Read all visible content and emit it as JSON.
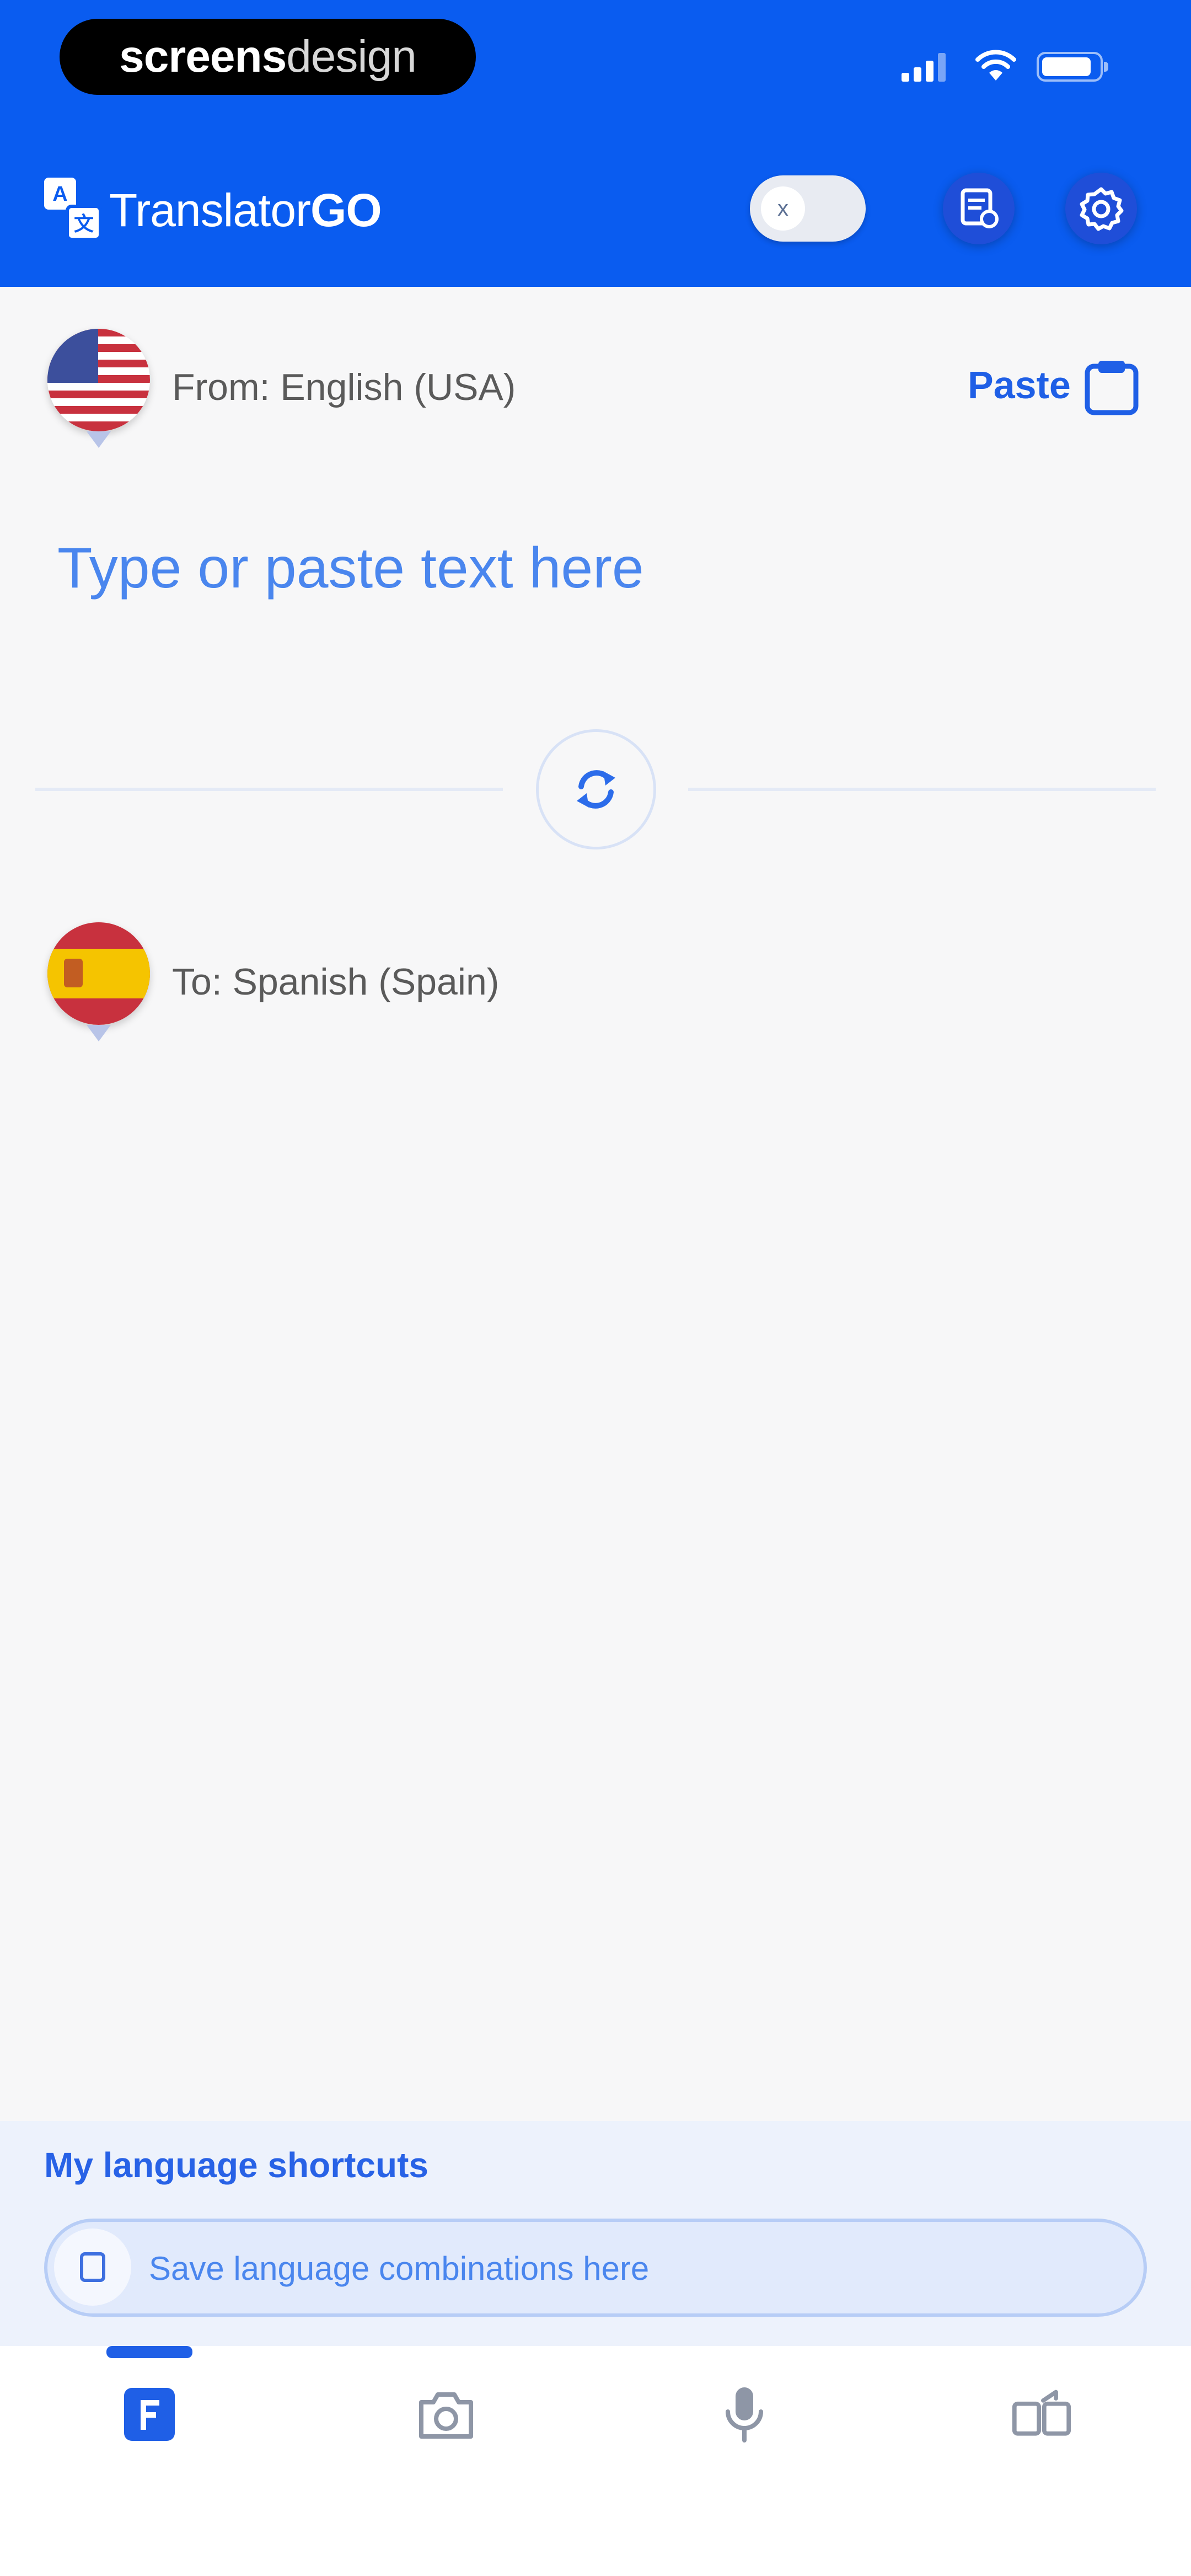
{
  "watermark": {
    "bold": "screens",
    "light": "design"
  },
  "header": {
    "app_title_prefix": "Translator",
    "app_title_suffix": "GO",
    "toggle_state_label": "x",
    "accent": "#0a5cf0"
  },
  "source": {
    "label": "From: English (USA)",
    "flag": "us-flag-icon",
    "paste_label": "Paste",
    "placeholder": "Type or paste text here"
  },
  "target": {
    "label": "To: Spanish (Spain)",
    "flag": "spain-flag-icon"
  },
  "shortcuts": {
    "title": "My language shortcuts",
    "pill_text": "Save language combinations here"
  },
  "bottom_nav": {
    "items": [
      {
        "icon": "text-translate-icon",
        "active": true
      },
      {
        "icon": "camera-icon",
        "active": false
      },
      {
        "icon": "microphone-icon",
        "active": false
      },
      {
        "icon": "conversation-icon",
        "active": false
      }
    ]
  }
}
